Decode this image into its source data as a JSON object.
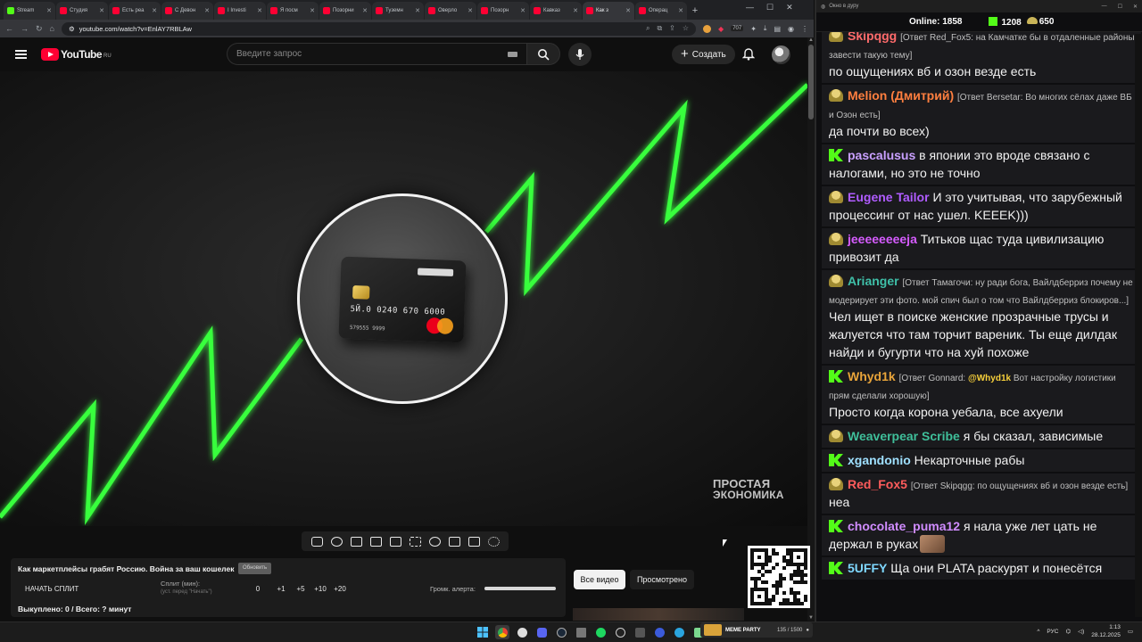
{
  "browser": {
    "tabs": [
      {
        "label": "Stream",
        "icon": "kick"
      },
      {
        "label": "Студия",
        "icon": "youtube"
      },
      {
        "label": "Есть реа",
        "icon": "youtube"
      },
      {
        "label": "С Девон",
        "icon": "youtube"
      },
      {
        "label": "I Investi",
        "icon": "youtube"
      },
      {
        "label": "Я посм",
        "icon": "youtube"
      },
      {
        "label": "Позорни",
        "icon": "youtube"
      },
      {
        "label": "Туземн",
        "icon": "youtube"
      },
      {
        "label": "Оверло",
        "icon": "youtube"
      },
      {
        "label": "Позорн",
        "icon": "youtube"
      },
      {
        "label": "Кавказ",
        "icon": "youtube"
      },
      {
        "label": "Как з",
        "icon": "youtube",
        "active": true
      },
      {
        "label": "Операц",
        "icon": "youtube"
      }
    ],
    "url": "youtube.com/watch?v=EnlAY7RBLAw",
    "extension_badge": "707"
  },
  "youtube": {
    "logo_text": "YouTube",
    "region": "RU",
    "search_placeholder": "Введите запрос",
    "create_label": "Создать"
  },
  "video": {
    "watermark_line1": "ПРОСТАЯ",
    "watermark_line2": "ЭКОНОМИКА",
    "card_number": "5Й.0 0240 670 6000",
    "card_sub": "579555 9999"
  },
  "split_panel": {
    "title": "Как маркетплейсы грабят Россию. Война за ваш кошелек",
    "refresh_label": "Обновить",
    "start_label": "НАЧАТЬ СПЛИТ",
    "split_label": "Сплит (мин):",
    "split_hint": "(уст. перед \"Начать\")",
    "split_value": "0",
    "increments": [
      "+1",
      "+5",
      "+10",
      "+20"
    ],
    "alert_volume_label": "Громк. алерта:",
    "alert_volume": 1.0,
    "bought_label": "Выкуплено: 0 / Всего: ? минут"
  },
  "actions": {
    "all_videos": "Все видео",
    "watched": "Просмотрено"
  },
  "chat": {
    "window_title": "Окно в дуру",
    "online_label": "Online:",
    "online_count": "1858",
    "kick_count": "1208",
    "trovo_count": "650",
    "messages": [
      {
        "platform": "trovo",
        "user": "Skipqgg",
        "color": "#ff6b6b",
        "reply": "[Ответ Red_Fox5: на Камчатке бы в отдаленные районы завести такую тему]",
        "text": "по ощущениях вб и озон везде есть"
      },
      {
        "platform": "trovo",
        "user": "Melion (Дмитрий)",
        "color": "#ff7f3f",
        "reply": "[Ответ Bersetar: Во многих сёлах даже ВБ и Озон есть]",
        "text": "да почти во всех)"
      },
      {
        "platform": "kick",
        "user": "pascalusus",
        "color": "#c9a0ff",
        "reply": "",
        "text": "в японии это вроде связано с налогами, но это не точно"
      },
      {
        "platform": "trovo",
        "user": "Eugene Tailor",
        "color": "#b05cff",
        "reply": "",
        "text": "И это учитывая, что зарубежный процессинг от нас ушел. KEEEK)))"
      },
      {
        "platform": "trovo",
        "user": "jeeeeeeeeja",
        "color": "#d65cff",
        "reply": "",
        "text": "Титьков щас туда цивилизацию привозит да"
      },
      {
        "platform": "trovo",
        "user": "Arianger",
        "color": "#3fbfa8",
        "reply": "[Ответ Тамагочи: ну ради бога, Вайлдберриз почему не модерирует эти фото. мой спич был о том что Вайлдберриз блокиров...]",
        "text": "Чел ищет в поиске женские прозрачные трусы и жалуется что там торчит вареник. Ты еще дилдак найди и бугурти что на хуй похоже"
      },
      {
        "platform": "kick",
        "user": "Whyd1k",
        "color": "#e8a43a",
        "reply": "[Ответ Gonnard: @Whyd1k Вот настройку логистики прям сделали хорошую]",
        "text": "Просто когда корона уебала, все ахуели"
      },
      {
        "platform": "trovo",
        "user": "Weaverpear Scribe",
        "color": "#3fbf9a",
        "reply": "",
        "text": "я бы сказал, зависимые"
      },
      {
        "platform": "kick",
        "user": "xgandonio",
        "color": "#9fe0ff",
        "reply": "",
        "text": "Некарточные рабы"
      },
      {
        "platform": "trovo",
        "user": "Red_Fox5",
        "color": "#ff5c5c",
        "reply": "[Ответ Skipqgg: по ощущениях вб и озон везде есть]",
        "text": "неа"
      },
      {
        "platform": "kick",
        "user": "chocolate_puma12",
        "color": "#d08cff",
        "reply": "",
        "text": "я нала уже лет цать не держал в руках",
        "emote": true
      },
      {
        "platform": "kick",
        "user": "5UFFY",
        "color": "#7fd8ff",
        "reply": "",
        "text": "Ща они PLATA раскурят и понесётся"
      }
    ]
  },
  "taskbar": {
    "media_title": "MEME PARTY",
    "media_counter": "135 / 1500",
    "lang": "РУС",
    "time": "1:13",
    "date": "28.12.2025"
  }
}
